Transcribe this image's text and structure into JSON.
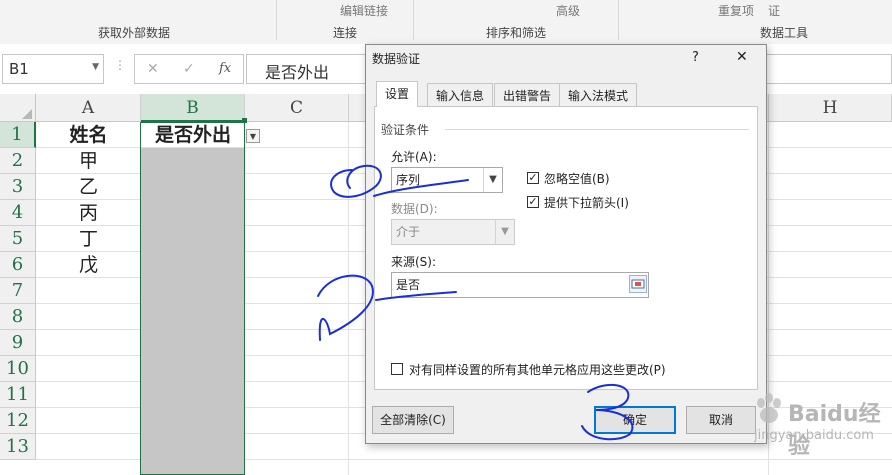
{
  "ribbon": {
    "groups": [
      "获取外部数据",
      "连接",
      "排序和筛选",
      "数据工具"
    ],
    "edit_links": "编辑链接",
    "advanced": "高级",
    "reapply": "重复项",
    "validate_frag": "证"
  },
  "formula_bar": {
    "name_box": "B1",
    "cancel_icon": "✕",
    "enter_icon": "✓",
    "fx": "fx",
    "content": "是否外出"
  },
  "sheet": {
    "columns": [
      "A",
      "B",
      "C",
      "H"
    ],
    "rows": [
      "1",
      "2",
      "3",
      "4",
      "5",
      "6",
      "7",
      "8",
      "9",
      "10",
      "11",
      "12",
      "13"
    ],
    "cells": {
      "A1": "姓名",
      "B1": "是否外出",
      "A2": "甲",
      "A3": "乙",
      "A4": "丙",
      "A5": "丁",
      "A6": "戊"
    }
  },
  "dialog": {
    "title": "数据验证",
    "help": "?",
    "close": "✕",
    "tabs": [
      "设置",
      "输入信息",
      "出错警告",
      "输入法模式"
    ],
    "section": "验证条件",
    "allow_label": "允许(A):",
    "allow_value": "序列",
    "ignore_blank": "忽略空值(B)",
    "dropdown": "提供下拉箭头(I)",
    "data_label": "数据(D):",
    "data_value": "介于",
    "source_label": "来源(S):",
    "source_value": "是否",
    "apply_all": "对有同样设置的所有其他单元格应用这些更改(P)",
    "clear_all": "全部清除(C)",
    "ok": "确定",
    "cancel": "取消"
  },
  "watermark": {
    "brand": "Baidu经验",
    "url": "jingyan.baidu.com"
  },
  "colors": {
    "excel_green": "#217346",
    "annotation_blue": "#1a2fd6",
    "selection_gray": "#c6c6c6"
  }
}
